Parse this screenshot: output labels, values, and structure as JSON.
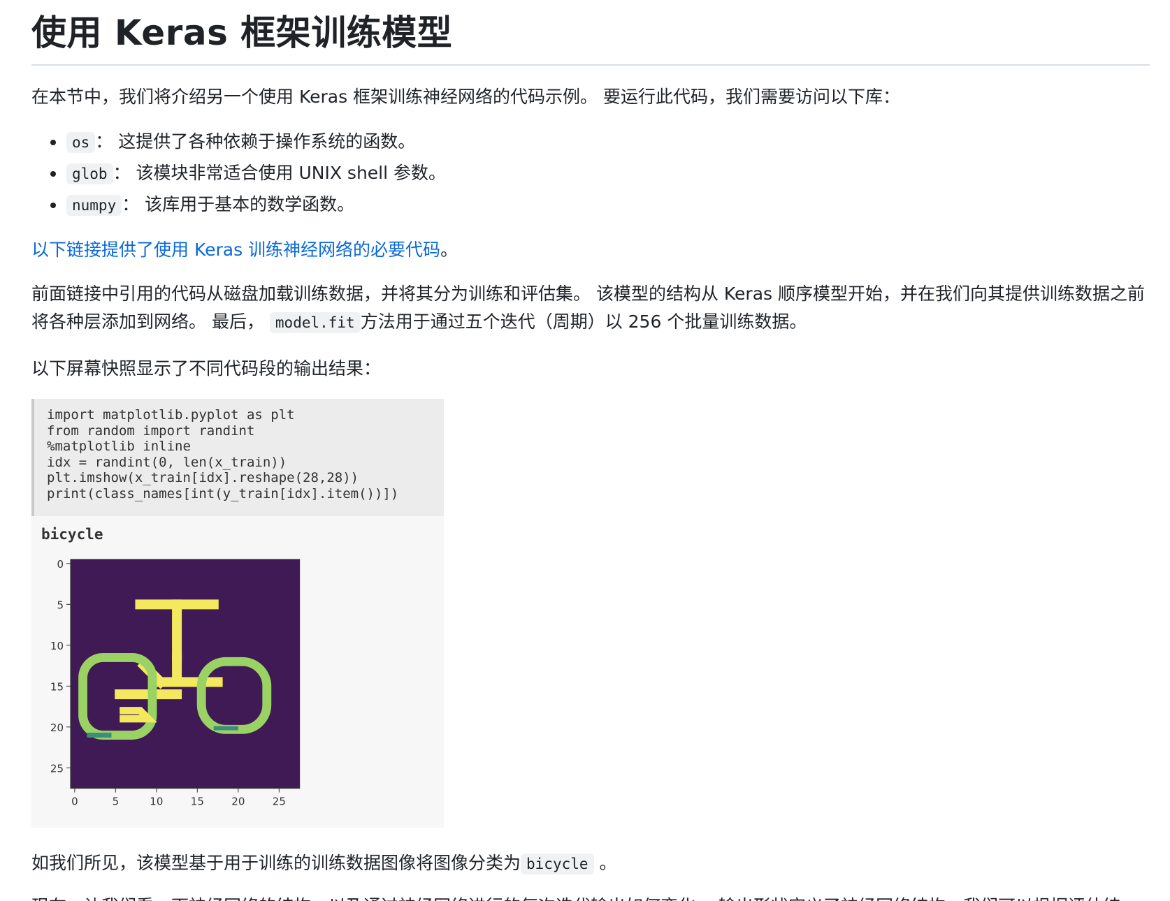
{
  "header": {
    "title": "使用 Keras 框架训练模型"
  },
  "intro": "在本节中，我们将介绍另一个使用 Keras 框架训练神经网络的代码示例。 要运行此代码，我们需要访问以下库：",
  "libraries": [
    {
      "code": "os",
      "desc": "：  这提供了各种依赖于操作系统的函数。"
    },
    {
      "code": "glob",
      "desc": "：  该模块非常适合使用 UNIX shell 参数。"
    },
    {
      "code": "numpy",
      "desc": "：  该库用于基本的数学函数。"
    }
  ],
  "link": {
    "text": "以下链接提供了使用 Keras 训练神经网络的必要代码",
    "suffix": "。"
  },
  "description": {
    "part1": "前面链接中引用的代码从磁盘加载训练数据，并将其分为训练和评估集。 该模型的结构从 Keras 顺序模型开始，并在我们向其提供训练数据之前将各种层添加到网络。 最后，",
    "code": "model.fit",
    "part2": "方法用于通过五个迭代（周期）以 256 个批量训练数据。"
  },
  "snapshot_intro": "以下屏幕快照显示了不同代码段的输出结果：",
  "figure": {
    "code_lines": [
      "import matplotlib.pyplot as plt",
      "from random import randint",
      "%matplotlib inline",
      "idx = randint(0, len(x_train))",
      "plt.imshow(x_train[idx].reshape(28,28))",
      "print(class_names[int(y_train[idx].item())])"
    ],
    "output_label": "bicycle",
    "image_bg_color": "#3f1a54",
    "stroke_color": "#f4e85e",
    "edge_color": "#3c8d7c",
    "mid_color": "#9ad364"
  },
  "chart_data": {
    "type": "heatmap",
    "title": "",
    "xlabel": "",
    "ylabel": "",
    "xlim": [
      0,
      27
    ],
    "ylim": [
      0,
      27
    ],
    "xticks": [
      0,
      5,
      10,
      15,
      20,
      25
    ],
    "yticks": [
      0,
      5,
      10,
      15,
      20,
      25
    ],
    "grid": false
  },
  "result": {
    "part1": "如我们所见，该模型基于用于训练的训练数据图像将图像分类为",
    "code": "bicycle",
    "part2": "。"
  },
  "next_partial": "现在，让我们看一下神经网络的结构，以及通过神经网络进行的每次迭代输出如何变化。 输出形状定义了神经网络结构，我们可以根据评估结"
}
